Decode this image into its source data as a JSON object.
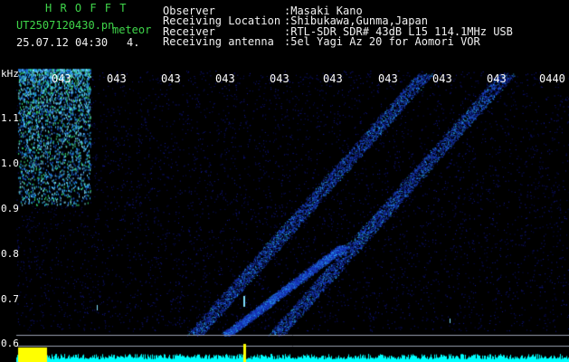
{
  "header": {
    "brand": "H R O F F T",
    "filename": "UT2507120430.pn",
    "tag": "meteor",
    "datetime": "25.07.12 04:30",
    "count": "4.",
    "info": [
      {
        "label": "Observer",
        "value": ":Masaki Kano"
      },
      {
        "label": "Receiving Location",
        "value": ":Shibukawa,Gunma,Japan"
      },
      {
        "label": "Receiver",
        "value": ":RTL-SDR SDR# 43dB L15 114.1MHz USB"
      },
      {
        "label": "Receiving antenna",
        "value": ":5el Yagi Az 20 for Aomori VOR"
      }
    ]
  },
  "spectrogram": {
    "unit": "kHz",
    "time_labels": [
      "043",
      "043",
      "043",
      "043",
      "043",
      "043",
      "043",
      "043",
      "043",
      "0440"
    ],
    "freq_labels": [
      "1.1",
      "1.0",
      "0.9",
      "0.8",
      "0.7",
      "0.6"
    ],
    "colors": {
      "background": "#000000",
      "noise": "#0a0f70",
      "signal": "#2ec0ff",
      "strong": "#ffff00",
      "trace": "#00ffff"
    }
  }
}
